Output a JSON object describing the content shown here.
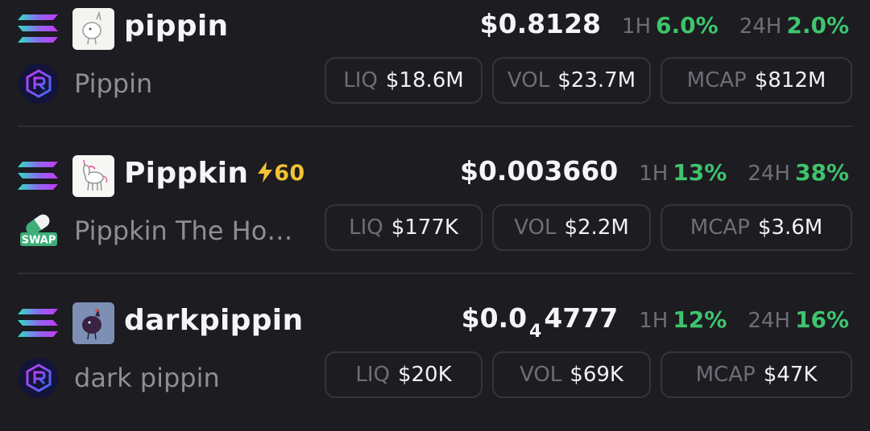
{
  "colors": {
    "background": "#1c1c21",
    "positive": "#3ec46d",
    "boost": "#f2c232",
    "muted": "#6e6e77",
    "pill_border": "#34343b"
  },
  "tokens": [
    {
      "chain_icon": "solana-icon",
      "dex_icon": "raydium-icon",
      "symbol": "pippin",
      "name": "Pippin",
      "price": "$0.8128",
      "h1_label": "1H",
      "h1": "6.0%",
      "h24_label": "24H",
      "h24": "2.0%",
      "liq_label": "LIQ",
      "liq": "$18.6M",
      "vol_label": "VOL",
      "vol": "$23.7M",
      "mcap_label": "MCAP",
      "mcap": "$812M"
    },
    {
      "chain_icon": "solana-icon",
      "dex_icon": "pumpswap-icon",
      "dex_icon_text": "SWAP",
      "symbol": "Pippkin",
      "boost": "60",
      "name": "Pippkin The Ho…",
      "price": "$0.003660",
      "h1_label": "1H",
      "h1": "13%",
      "h24_label": "24H",
      "h24": "38%",
      "liq_label": "LIQ",
      "liq": "$177K",
      "vol_label": "VOL",
      "vol": "$2.2M",
      "mcap_label": "MCAP",
      "mcap": "$3.6M"
    },
    {
      "chain_icon": "solana-icon",
      "dex_icon": "raydium-icon",
      "symbol": "darkpippin",
      "name": "dark pippin",
      "price_main": "$0.0",
      "price_sub": "4",
      "price_rest": "4777",
      "h1_label": "1H",
      "h1": "12%",
      "h24_label": "24H",
      "h24": "16%",
      "liq_label": "LIQ",
      "liq": "$20K",
      "vol_label": "VOL",
      "vol": "$69K",
      "mcap_label": "MCAP",
      "mcap": "$47K"
    }
  ]
}
